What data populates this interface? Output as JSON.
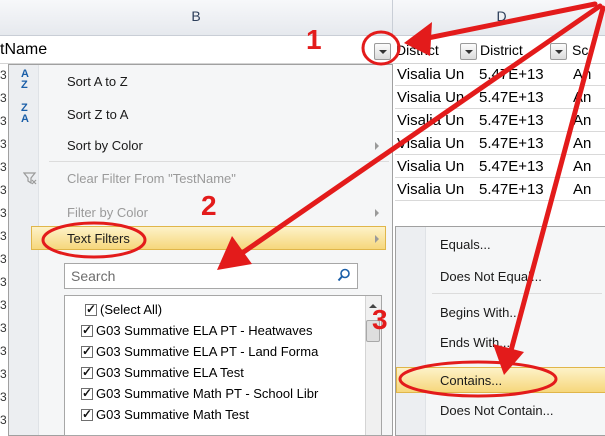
{
  "columns": {
    "b": "B",
    "d": "D"
  },
  "header_cells": {
    "b_title": "tName",
    "d1": "District",
    "d2": "District",
    "d3": "Sc"
  },
  "row_stubs": [
    "3",
    "3",
    "3",
    "3",
    "3",
    "3",
    "3",
    "3",
    "3",
    "3",
    "3",
    "3",
    "3",
    "3",
    "3",
    "3"
  ],
  "grid_rows": [
    {
      "a": "Visalia Un",
      "b": "5.47E+13",
      "c": "An"
    },
    {
      "a": "Visalia Un",
      "b": "5.47E+13",
      "c": "An"
    },
    {
      "a": "Visalia Un",
      "b": "5.47E+13",
      "c": "An"
    },
    {
      "a": "Visalia Un",
      "b": "5.47E+13",
      "c": "An"
    },
    {
      "a": "Visalia Un",
      "b": "5.47E+13",
      "c": "An"
    },
    {
      "a": "Visalia Un",
      "b": "5.47E+13",
      "c": "An"
    }
  ],
  "menu": {
    "sort_az": "Sort A to Z",
    "sort_za": "Sort Z to A",
    "sort_color": "Sort by Color",
    "clear_filter": "Clear Filter From \"TestName\"",
    "filter_color": "Filter by Color",
    "text_filters": "Text Filters",
    "search_placeholder": "Search"
  },
  "sort_icons": {
    "az_top": "A",
    "az_bottom": "Z",
    "za_top": "Z",
    "za_bottom": "A"
  },
  "list_items": [
    "(Select All)",
    "G03 Summative ELA PT - Heatwaves",
    "G03 Summative ELA PT - Land Forma",
    "G03 Summative ELA Test",
    "G03 Summative Math PT - School Libr",
    "G03 Summative Math Test"
  ],
  "submenu": {
    "equals": "Equals...",
    "not_equal": "Does Not Equal...",
    "begins_with": "Begins With...",
    "ends_with": "Ends With...",
    "contains": "Contains...",
    "not_contain": "Does Not Contain..."
  },
  "annotations": {
    "n1": "1",
    "n2": "2",
    "n3": "3",
    "color": "#e31b1b"
  }
}
